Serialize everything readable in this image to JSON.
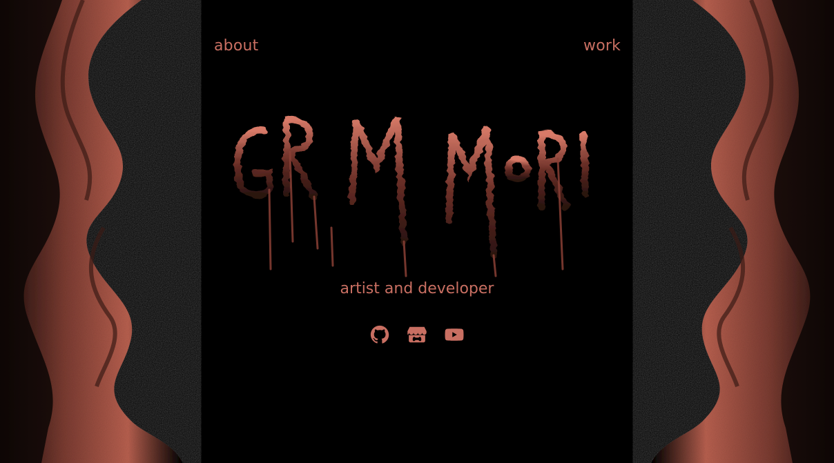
{
  "nav": {
    "about_label": "about",
    "work_label": "work"
  },
  "logo": {
    "text": "GRIM MORI"
  },
  "hero": {
    "tagline": "artist and developer"
  },
  "socials": [
    {
      "icon": "github-icon"
    },
    {
      "icon": "itchio-icon"
    },
    {
      "icon": "youtube-icon"
    }
  ],
  "colors": {
    "accent": "#c96f62",
    "background": "#000000"
  }
}
